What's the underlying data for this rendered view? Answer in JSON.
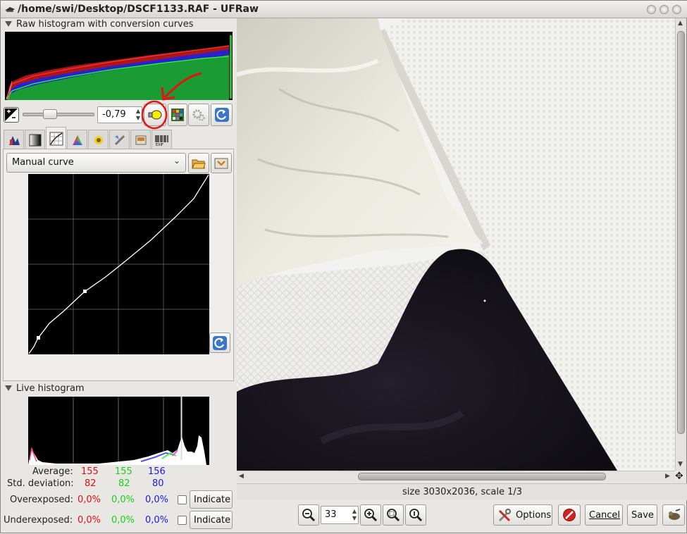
{
  "window": {
    "title": "/home/swi/Desktop/DSCF1133.RAF - UFRaw"
  },
  "raw_histogram": {
    "header": "Raw histogram with conversion curves"
  },
  "exposure": {
    "value": "-0,79",
    "slider_fraction": 0.38
  },
  "curve": {
    "preset": "Manual curve"
  },
  "live_histogram": {
    "header": "Live histogram",
    "average_label": "Average:",
    "std_label": "Std. deviation:",
    "over_label": "Overexposed:",
    "under_label": "Underexposed:",
    "average": {
      "r": "155",
      "g": "155",
      "b": "156"
    },
    "std": {
      "r": "82",
      "g": "82",
      "b": "80"
    },
    "over": {
      "r": "0,0%",
      "g": "0,0%",
      "b": "0,0%"
    },
    "under": {
      "r": "0,0%",
      "g": "0,0%",
      "b": "0,0%"
    },
    "indicate_label": "Indicate"
  },
  "preview": {
    "status": "size 3030x2036, scale 1/3",
    "zoom_value": "33"
  },
  "actions": {
    "options": "Options",
    "cancel": "Cancel",
    "save": "Save"
  },
  "colors": {
    "red": "#e01010",
    "green": "#19d019",
    "blue": "#1a1ae0",
    "annotation": "#e81010"
  }
}
